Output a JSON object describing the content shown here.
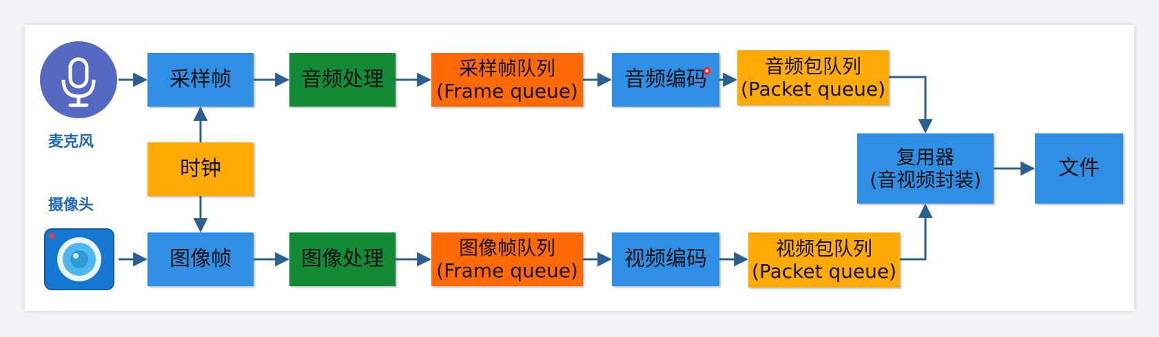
{
  "sources": {
    "microphone_label": "麦克风",
    "camera_label": "摄像头"
  },
  "audio_row": {
    "sample_frame": "采样帧",
    "processing": "音频处理",
    "frame_queue_line1": "采样帧队列",
    "frame_queue_line2": "(Frame queue)",
    "encoder": "音频编码",
    "packet_queue_line1": "音频包队列",
    "packet_queue_line2": "(Packet queue)"
  },
  "clock": "时钟",
  "video_row": {
    "image_frame": "图像帧",
    "processing": "图像处理",
    "frame_queue_line1": "图像帧队列",
    "frame_queue_line2": "(Frame queue)",
    "encoder": "视频编码",
    "packet_queue_line1": "视频包队列",
    "packet_queue_line2": "(Packet queue)"
  },
  "muxer": {
    "line1": "复用器",
    "line2": "(音视频封装)"
  },
  "file": "文件",
  "colors": {
    "blue": "#2f8fe4",
    "green": "#138a35",
    "orange": "#ff6a05",
    "amber": "#ffaa05",
    "arrow": "#2a5f93",
    "label": "#2368b8",
    "mic_circle": "#5569c2"
  },
  "icons": {
    "microphone": "microphone-icon",
    "camera": "camera-icon"
  }
}
